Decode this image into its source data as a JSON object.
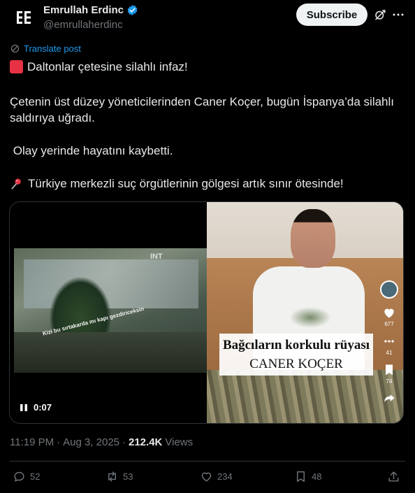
{
  "author": {
    "display_name": "Emrullah Erdinc",
    "handle": "@emrullaherdinc",
    "verified": true
  },
  "actions_header": {
    "subscribe_label": "Subscribe"
  },
  "translate_label": "Translate post",
  "post": {
    "line1": "Daltonlar çetesine silahlı infaz!",
    "line2": "Çetenin üst düzey yöneticilerinden Caner Koçer, bugün İspanya’da silahlı saldırıya uğradı.",
    "line3": "Olay yerinde hayatını kaybetti.",
    "line4": "Türkiye merkezli suç örgütlerinin gölgesi artık sınır ötesinde!"
  },
  "media": {
    "video_time": "0:07",
    "video_sign": "INT",
    "video_overlay": "Kizi bu sırtakarda mı kapı gezdiriceksin",
    "caption_line1": "Bağcıların korkulu rüyası",
    "caption_line2": "CANER KOÇER",
    "side_counts": [
      "677",
      "41",
      "74"
    ]
  },
  "meta": {
    "time": "11:19 PM",
    "separator": "·",
    "date": "Aug 3, 2025",
    "views_count": "212.4K",
    "views_label": "Views"
  },
  "stats": {
    "replies": "52",
    "reposts": "53",
    "likes": "234",
    "bookmarks": "48"
  },
  "colors": {
    "background": "#000000",
    "text": "#e7e9ea",
    "muted": "#71767b",
    "link": "#1d9bf0",
    "verified": "#1d9bf0",
    "red_square": "#e63244"
  }
}
